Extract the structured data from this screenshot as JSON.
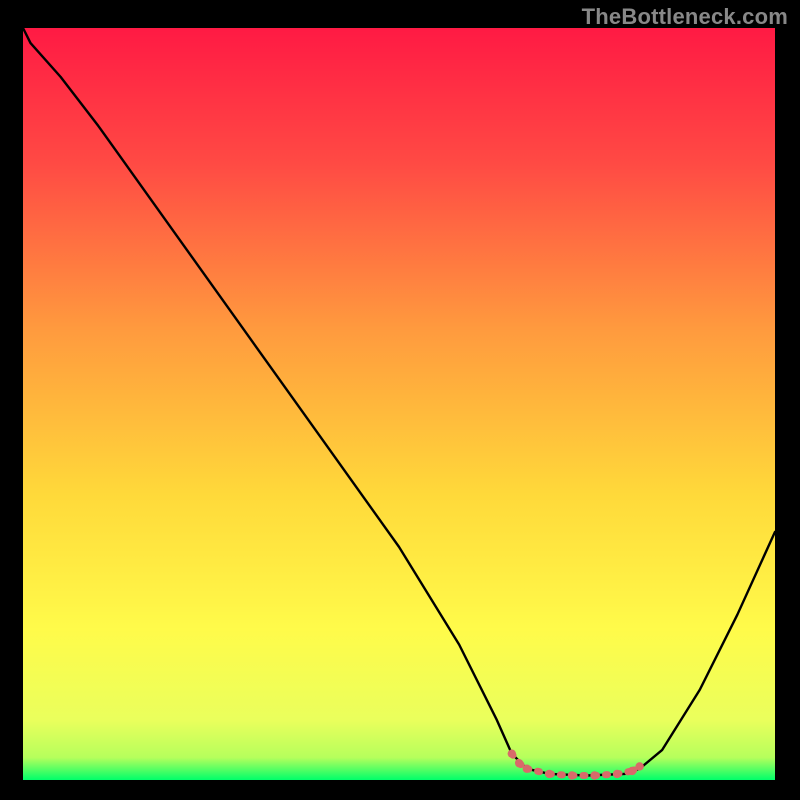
{
  "watermark": "TheBottleneck.com",
  "chart_data": {
    "type": "line",
    "title": "",
    "xlabel": "",
    "ylabel": "",
    "xlim": [
      0,
      100
    ],
    "ylim": [
      0,
      100
    ],
    "background_gradient": {
      "top": "#ff1a44",
      "mid_upper": "#ff8044",
      "mid": "#ffe84a",
      "lower": "#f7ff70",
      "bottom": "#00ff66"
    },
    "series": [
      {
        "name": "bottleneck-curve",
        "color": "#000000",
        "points": [
          {
            "x": 0,
            "y": 100
          },
          {
            "x": 1,
            "y": 98
          },
          {
            "x": 5,
            "y": 93.5
          },
          {
            "x": 10,
            "y": 87
          },
          {
            "x": 20,
            "y": 73
          },
          {
            "x": 30,
            "y": 59
          },
          {
            "x": 40,
            "y": 45
          },
          {
            "x": 50,
            "y": 31
          },
          {
            "x": 58,
            "y": 18
          },
          {
            "x": 63,
            "y": 8
          },
          {
            "x": 65,
            "y": 3.5
          },
          {
            "x": 67,
            "y": 1.5
          },
          {
            "x": 70,
            "y": 0.8
          },
          {
            "x": 75,
            "y": 0.6
          },
          {
            "x": 80,
            "y": 0.8
          },
          {
            "x": 82,
            "y": 1.5
          },
          {
            "x": 85,
            "y": 4
          },
          {
            "x": 90,
            "y": 12
          },
          {
            "x": 95,
            "y": 22
          },
          {
            "x": 100,
            "y": 33
          }
        ]
      },
      {
        "name": "optimal-zone-marker",
        "color": "#d86a6a",
        "style": "thick-dotted",
        "points": [
          {
            "x": 65,
            "y": 3.5
          },
          {
            "x": 66,
            "y": 2.2
          },
          {
            "x": 67,
            "y": 1.5
          },
          {
            "x": 70,
            "y": 0.8
          },
          {
            "x": 73,
            "y": 0.6
          },
          {
            "x": 76,
            "y": 0.6
          },
          {
            "x": 79,
            "y": 0.8
          },
          {
            "x": 81,
            "y": 1.2
          },
          {
            "x": 82,
            "y": 1.8
          }
        ]
      }
    ]
  }
}
